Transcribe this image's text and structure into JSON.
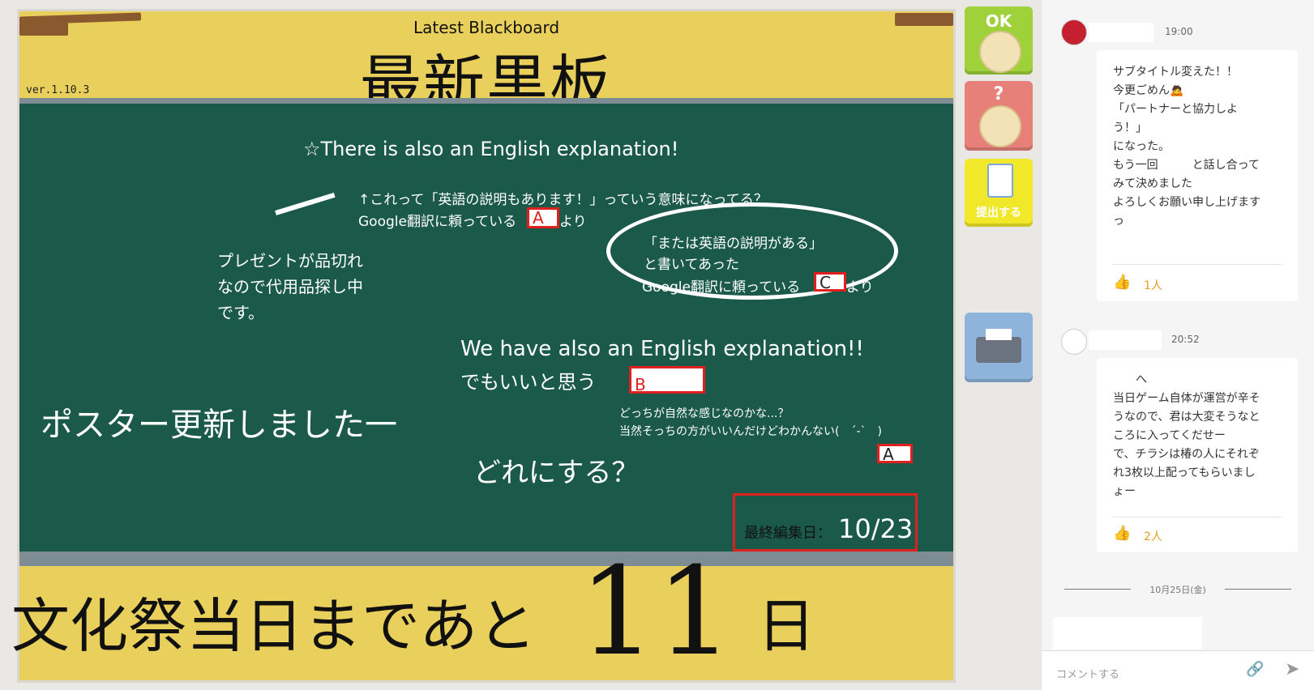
{
  "board": {
    "subtitle": "Latest Blackboard",
    "title": "最新黒板",
    "version": "ver.1.10.3",
    "chalk_lines": {
      "english_note": "☆There is also an English explanation!",
      "question_line1": "↑これって「英語の説明もあります！」っていう意味になってる？",
      "question_line2": "Google翻訳に頼っている",
      "question_line2_suffix": "より",
      "box_a1": "A",
      "present_line1": "プレゼントが品切れ",
      "present_line2": "なので代用品探し中",
      "present_line3": "です。",
      "oval_line1": "「または英語の説明がある」",
      "oval_line2": "と書いてあった",
      "oval_line3": "Google翻訳に頼っている",
      "oval_suffix": "より",
      "box_c": "C",
      "we_have": "We have  also an English explanation!!",
      "demoii": "でもいいと思う",
      "box_b": "B",
      "poster": "ポスター更新しました一",
      "natural_line1": "どっちが自然な感じなのかな...？",
      "natural_line2": "当然そっちの方がいいんだけどわかんない(　´-`　)",
      "box_a2": "A",
      "which": "どれにする？",
      "edit_label": "最終編集日：",
      "edit_date": "10/23"
    },
    "countdown_text": "文化祭当日まであと",
    "countdown_days": "11",
    "countdown_unit": "日"
  },
  "side_buttons": {
    "ok_label": "OK",
    "question_label": "?",
    "submit_label": "提出する"
  },
  "chat": {
    "messages": [
      {
        "time": "19:00",
        "lines": "サブタイトル変えた！！\n今更ごめん🙇\n「パートナーと協力しよ\nう！」\nになった。\nもう一回　　　と話し合って\nみて決めました\nよろしくお願い申し上げます\nっ",
        "likes": "1人"
      },
      {
        "time": "20:52",
        "lines": "　　へ\n当日ゲーム自体が運営が辛そ\nうなので、君は大変そうなと\nころに入ってくだせー\nで、チラシは椿の人にそれぞ\nれ3枚以上配ってもらいまし\nょー",
        "likes": "2人"
      }
    ],
    "date_divider": "10月25日(金)",
    "comment_placeholder": "コメントする"
  },
  "colors": {
    "chalkboard": "#1b5a4a",
    "board_frame": "#e9d05c",
    "highlight_red": "#e02020",
    "ok_green": "#9fd23a",
    "question_red": "#e8807a",
    "submit_yellow": "#f2e82a",
    "print_blue": "#8fb4dc",
    "like_orange": "#e0a020"
  }
}
